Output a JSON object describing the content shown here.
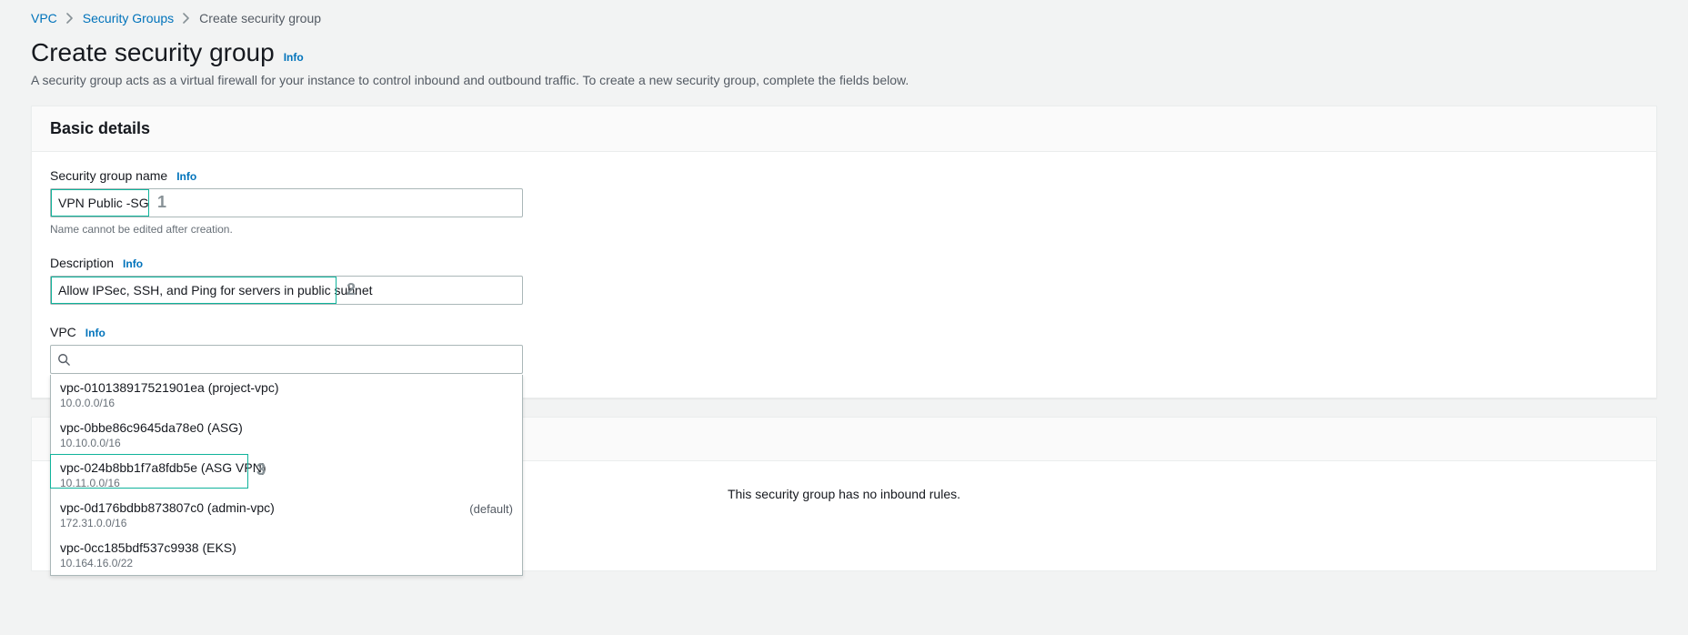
{
  "breadcrumbs": {
    "items": [
      {
        "label": "VPC",
        "link": true
      },
      {
        "label": "Security Groups",
        "link": true
      },
      {
        "label": "Create security group",
        "link": false
      }
    ]
  },
  "header": {
    "title": "Create security group",
    "info": "Info",
    "subtitle": "A security group acts as a virtual firewall for your instance to control inbound and outbound traffic. To create a new security group, complete the fields below."
  },
  "basic_details": {
    "section_title": "Basic details",
    "name": {
      "label": "Security group name",
      "info": "Info",
      "value": "VPN Public -SG",
      "help": "Name cannot be edited after creation."
    },
    "description": {
      "label": "Description",
      "info": "Info",
      "value": "Allow IPSec, SSH, and Ping for servers in public subnet"
    },
    "vpc": {
      "label": "VPC",
      "info": "Info",
      "value": "",
      "options": [
        {
          "primary": "vpc-010138917521901ea (project-vpc)",
          "secondary": "10.0.0.0/16",
          "flag": ""
        },
        {
          "primary": "vpc-0bbe86c9645da78e0 (ASG)",
          "secondary": "10.10.0.0/16",
          "flag": ""
        },
        {
          "primary": "vpc-024b8bb1f7a8fdb5e (ASG VPN)",
          "secondary": "10.11.0.0/16",
          "flag": ""
        },
        {
          "primary": "vpc-0d176bdbb873807c0 (admin-vpc)",
          "secondary": "172.31.0.0/16",
          "flag": "(default)"
        },
        {
          "primary": "vpc-0cc185bdf537c9938 (EKS)",
          "secondary": "10.164.16.0/22",
          "flag": ""
        }
      ]
    }
  },
  "inbound_rules": {
    "empty_text": "This security group has no inbound rules."
  },
  "annotations": {
    "one": "1",
    "two": "2",
    "three": "3"
  }
}
